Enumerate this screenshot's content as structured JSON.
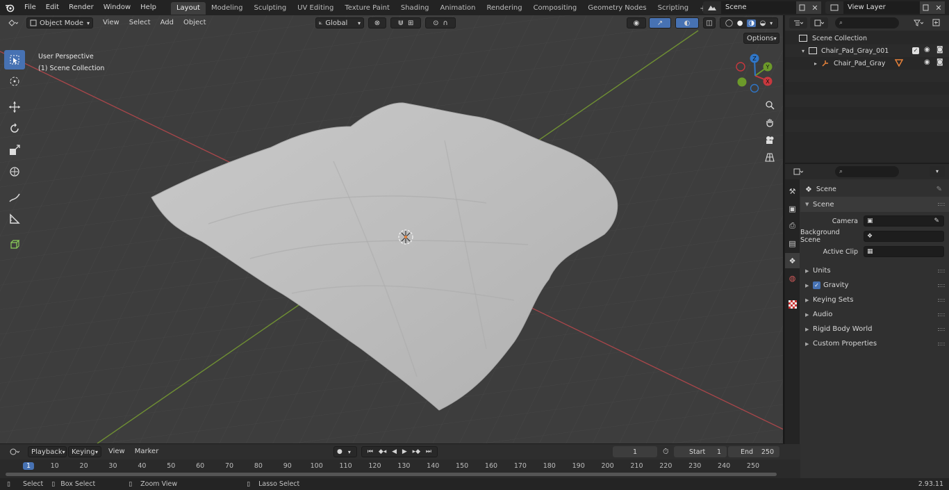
{
  "topbar": {
    "menus": [
      "File",
      "Edit",
      "Render",
      "Window",
      "Help"
    ],
    "workspaces": [
      "Layout",
      "Modeling",
      "Sculpting",
      "UV Editing",
      "Texture Paint",
      "Shading",
      "Animation",
      "Rendering",
      "Compositing",
      "Geometry Nodes",
      "Scripting"
    ],
    "active_workspace": "Layout",
    "add_tab": "+",
    "scene_name": "Scene",
    "view_layer": "View Layer"
  },
  "viewport": {
    "mode": "Object Mode",
    "menus": [
      "View",
      "Select",
      "Add",
      "Object"
    ],
    "orientation": "Global",
    "options_label": "Options",
    "overlay_line1": "User Perspective",
    "overlay_line2": "(1) Scene Collection",
    "axes": {
      "x": "X",
      "y": "Y",
      "z": "Z"
    }
  },
  "outliner": {
    "root": "Scene Collection",
    "items": [
      {
        "label": "Chair_Pad_Gray_001"
      },
      {
        "label": "Chair_Pad_Gray"
      }
    ]
  },
  "properties": {
    "context": "Scene",
    "panel_scene": "Scene",
    "fields": [
      {
        "label": "Camera"
      },
      {
        "label": "Background Scene"
      },
      {
        "label": "Active Clip"
      }
    ],
    "panels": [
      "Units",
      "Gravity",
      "Keying Sets",
      "Audio",
      "Rigid Body World",
      "Custom Properties"
    ]
  },
  "timeline": {
    "menus": [
      "Playback",
      "Keying",
      "View",
      "Marker"
    ],
    "current_frame": "1",
    "start_label": "Start",
    "start": "1",
    "end_label": "End",
    "end": "250",
    "ruler": [
      "1",
      "10",
      "20",
      "30",
      "40",
      "50",
      "60",
      "70",
      "80",
      "90",
      "100",
      "110",
      "120",
      "130",
      "140",
      "150",
      "160",
      "170",
      "180",
      "190",
      "200",
      "210",
      "220",
      "230",
      "240",
      "250"
    ]
  },
  "statusbar": {
    "select": "Select",
    "box_select": "Box Select",
    "zoom_view": "Zoom View",
    "lasso_select": "Lasso Select",
    "version": "2.93.11"
  },
  "colors": {
    "accent": "#4772b3",
    "x_axis": "#c8383e",
    "y_axis": "#6c9a2a",
    "z_axis": "#2f76c8",
    "object_orange": "#e8823a"
  }
}
